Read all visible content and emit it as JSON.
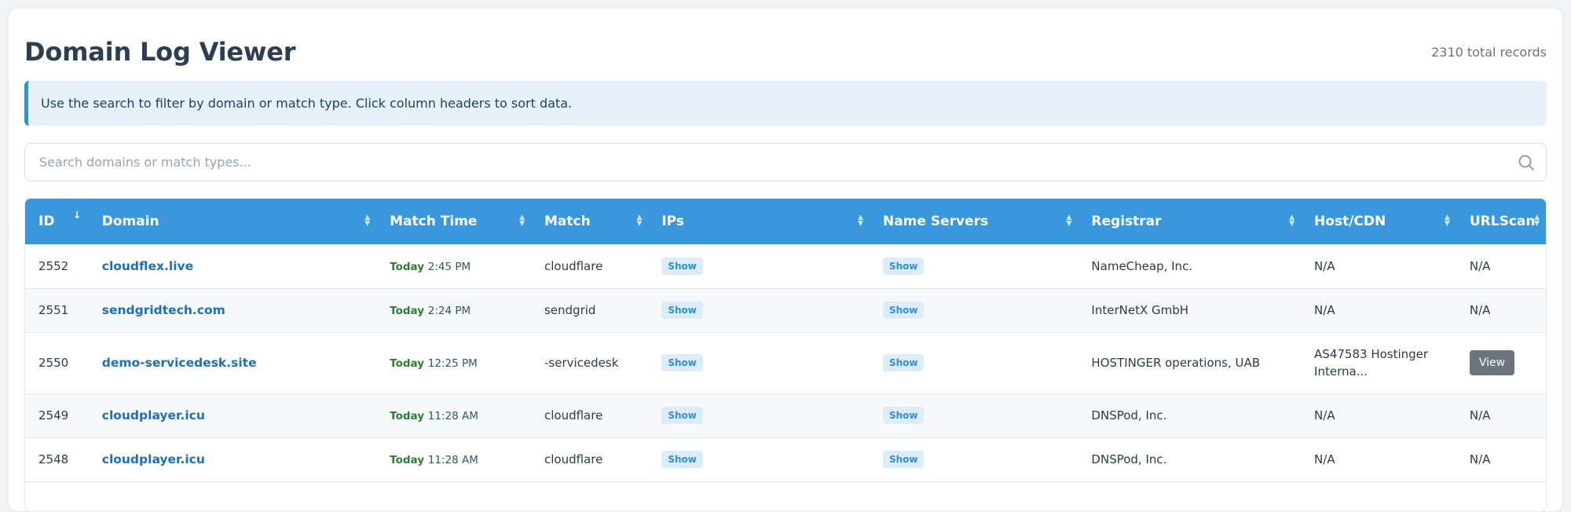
{
  "header": {
    "title": "Domain Log Viewer",
    "record_count": "2310 total records"
  },
  "info": {
    "message": "Use the search to filter by domain or match type. Click column headers to sort data."
  },
  "search": {
    "placeholder": "Search domains or match types..."
  },
  "table": {
    "columns": [
      "ID",
      "Domain",
      "Match Time",
      "Match",
      "IPs",
      "Name Servers",
      "Registrar",
      "Host/CDN",
      "URLScan"
    ],
    "rows": [
      {
        "id": "2552",
        "domain": "cloudflex.live",
        "day": "Today",
        "time": "2:45 PM",
        "match": "cloudflare",
        "ips": "Show",
        "ns": "Show",
        "registrar": "NameCheap, Inc.",
        "host": "N/A",
        "urlscan": "N/A"
      },
      {
        "id": "2551",
        "domain": "sendgridtech.com",
        "day": "Today",
        "time": "2:24 PM",
        "match": "sendgrid",
        "ips": "Show",
        "ns": "Show",
        "registrar": "InterNetX GmbH",
        "host": "N/A",
        "urlscan": "N/A"
      },
      {
        "id": "2550",
        "domain": "demo-servicedesk.site",
        "day": "Today",
        "time": "12:25 PM",
        "match": "-servicedesk",
        "ips": "Show",
        "ns": "Show",
        "registrar": "HOSTINGER operations, UAB",
        "host": "AS47583 Hostinger Interna...",
        "urlscan": "View"
      },
      {
        "id": "2549",
        "domain": "cloudplayer.icu",
        "day": "Today",
        "time": "11:28 AM",
        "match": "cloudflare",
        "ips": "Show",
        "ns": "Show",
        "registrar": "DNSPod, Inc.",
        "host": "N/A",
        "urlscan": "N/A"
      },
      {
        "id": "2548",
        "domain": "cloudplayer.icu",
        "day": "Today",
        "time": "11:28 AM",
        "match": "cloudflare",
        "ips": "Show",
        "ns": "Show",
        "registrar": "DNSPod, Inc.",
        "host": "N/A",
        "urlscan": "N/A"
      }
    ]
  },
  "colors": {
    "header_bg": "#3b97dd",
    "link": "#1d6fbd",
    "today": "#2e7d32",
    "badge_bg": "#dcecf9",
    "view_button": "#6c757d"
  }
}
